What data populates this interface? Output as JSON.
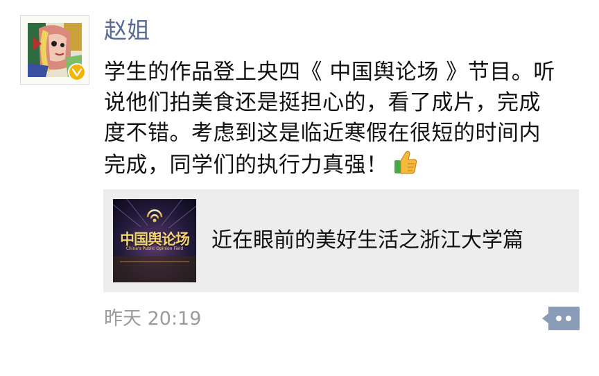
{
  "post": {
    "author": "赵姐",
    "text_lines": [
      "学生的作品登上央四《 中国舆论场 》节目。听",
      "说他们拍美食还是挺担心的，看了成片，完成",
      "度不错。考虑到这是临近寒假在很短的时间内",
      "完成，同学们的执行力真强！"
    ],
    "emoji": "thumbs-up-icon",
    "link_card": {
      "title": "近在眼前的美好生活之浙江大学篇",
      "thumbnail_logo_text": "中国舆论场",
      "thumbnail_en_text": "China's Public Opinion Field"
    },
    "timestamp": "昨天 20:19"
  },
  "colors": {
    "nickname": "#576b95",
    "text": "#111111",
    "card_bg": "#ededed",
    "timestamp": "#9b9b9b",
    "more_button": "#8a9cb7"
  }
}
